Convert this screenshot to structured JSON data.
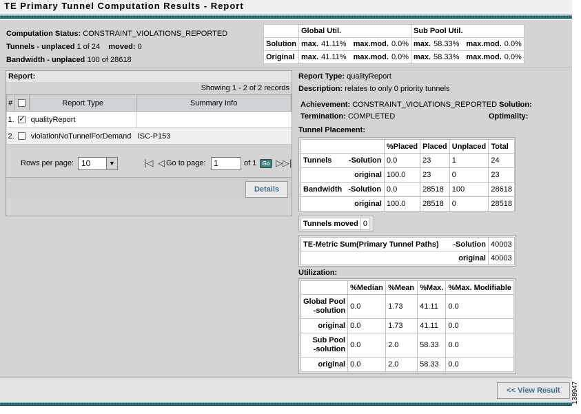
{
  "title": "TE Primary Tunnel Computation Results - Report",
  "status": {
    "computation_status_label": "Computation Status:",
    "computation_status_value": "CONSTRAINT_VIOLATIONS_REPORTED",
    "tunnels_unplaced_label": "Tunnels - unplaced",
    "tunnels_unplaced_value": "1 of 24",
    "moved_label": "moved:",
    "moved_value": "0",
    "bandwidth_unplaced_label": "Bandwidth - unplaced",
    "bandwidth_unplaced_value": "100 of 28618"
  },
  "util_summary": {
    "headers": [
      "",
      "Global Util.",
      "Sub Pool Util."
    ],
    "max_label": "max.",
    "maxmod_label": "max.mod.",
    "rows": [
      {
        "label": "Solution",
        "g_max": "41.11%",
        "g_mod": "0.0%",
        "s_max": "58.33%",
        "s_mod": "0.0%"
      },
      {
        "label": "Original",
        "g_max": "41.11%",
        "g_mod": "0.0%",
        "s_max": "58.33%",
        "s_mod": "0.0%"
      }
    ]
  },
  "report": {
    "header": "Report:",
    "showing": "Showing 1 - 2 of 2 records",
    "columns": [
      "#",
      "",
      "Report Type",
      "Summary Info"
    ],
    "rows": [
      {
        "num": "1.",
        "checked": true,
        "type": "qualityReport",
        "summary": ""
      },
      {
        "num": "2.",
        "checked": false,
        "type": "violationNoTunnelForDemand",
        "summary": "ISC-P153"
      }
    ],
    "rows_per_page_label": "Rows per page:",
    "rows_per_page_value": "10",
    "goto_label": "Go to page:",
    "goto_value": "1",
    "of_label": "of 1",
    "go_label": "Go",
    "details_label": "Details"
  },
  "detail": {
    "report_type_label": "Report Type:",
    "report_type_value": "qualityReport",
    "description_label": "Description:",
    "description_value": "relates to only 0 priority tunnels",
    "achievement_label": "Achievement:",
    "achievement_value": "CONSTRAINT_VIOLATIONS_REPORTED",
    "solution_label": "Solution:",
    "termination_label": "Termination:",
    "termination_value": "COMPLETED",
    "optimality_label": "Optimality:",
    "tunnel_placement_label": "Tunnel Placement:",
    "placement_headers": [
      "",
      "%Placed",
      "Placed",
      "Unplaced",
      "Total"
    ],
    "placement_rows": [
      {
        "label": "Tunnels        -Solution",
        "placed_pct": "0.0",
        "placed": "23",
        "unplaced": "1",
        "total": "24"
      },
      {
        "label": "original",
        "placed_pct": "100.0",
        "placed": "23",
        "unplaced": "0",
        "total": "23"
      },
      {
        "label": "Bandwidth   -Solution",
        "placed_pct": "0.0",
        "placed": "28518",
        "unplaced": "100",
        "total": "28618"
      },
      {
        "label": "original",
        "placed_pct": "100.0",
        "placed": "28518",
        "unplaced": "0",
        "total": "28518"
      }
    ],
    "tunnels_moved_label": "Tunnels moved",
    "tunnels_moved_value": "0",
    "metric_label": "TE-Metric Sum(Primary Tunnel Paths)",
    "metric_solution_label": "-Solution",
    "metric_solution_value": "40003",
    "metric_original_label": "original",
    "metric_original_value": "40003",
    "utilization_label": "Utilization:",
    "util_headers": [
      "",
      "%Median",
      "%Mean",
      "%Max.",
      "%Max. Modifiable"
    ],
    "util_rows": [
      {
        "label1": "Global Pool",
        "label2": "-solution",
        "median": "0.0",
        "mean": "1.73",
        "max": "41.11",
        "maxmod": "0.0"
      },
      {
        "label1": "",
        "label2": "original",
        "median": "0.0",
        "mean": "1.73",
        "max": "41.11",
        "maxmod": "0.0"
      },
      {
        "label1": "Sub Pool",
        "label2": "-solution",
        "median": "0.0",
        "mean": "2.0",
        "max": "58.33",
        "maxmod": "0.0"
      },
      {
        "label1": "",
        "label2": "original",
        "median": "0.0",
        "mean": "2.0",
        "max": "58.33",
        "maxmod": "0.0"
      }
    ]
  },
  "view_result_label": "<< View Result",
  "figure_id": "138947"
}
